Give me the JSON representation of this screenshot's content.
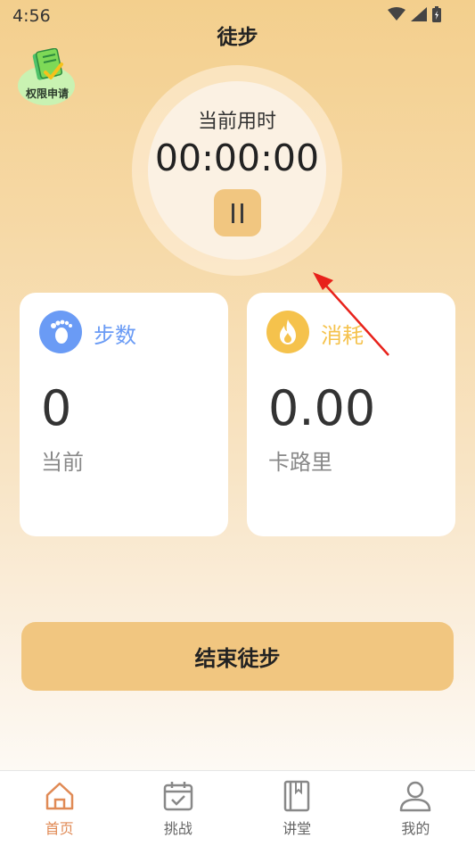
{
  "status_bar": {
    "time": "4:56"
  },
  "page": {
    "title": "徒步"
  },
  "permission_badge": {
    "label": "权限申请"
  },
  "timer": {
    "label": "当前用时",
    "value": "00:00:00"
  },
  "cards": [
    {
      "title": "步数",
      "value": "0",
      "unit": "当前",
      "icon": "footprint-icon",
      "color": "#6a9bf5"
    },
    {
      "title": "消耗",
      "value": "0.00",
      "unit": "卡路里",
      "icon": "flame-icon",
      "color": "#f5c24c"
    }
  ],
  "end_button": {
    "label": "结束徒步"
  },
  "bottom_nav": [
    {
      "label": "首页",
      "icon": "home-icon",
      "active": true
    },
    {
      "label": "挑战",
      "icon": "calendar-check-icon",
      "active": false
    },
    {
      "label": "讲堂",
      "icon": "book-icon",
      "active": false
    },
    {
      "label": "我的",
      "icon": "user-icon",
      "active": false
    }
  ],
  "colors": {
    "accent": "#f1c680",
    "active_nav": "#e08a55",
    "annotation_arrow": "#e8221b"
  }
}
